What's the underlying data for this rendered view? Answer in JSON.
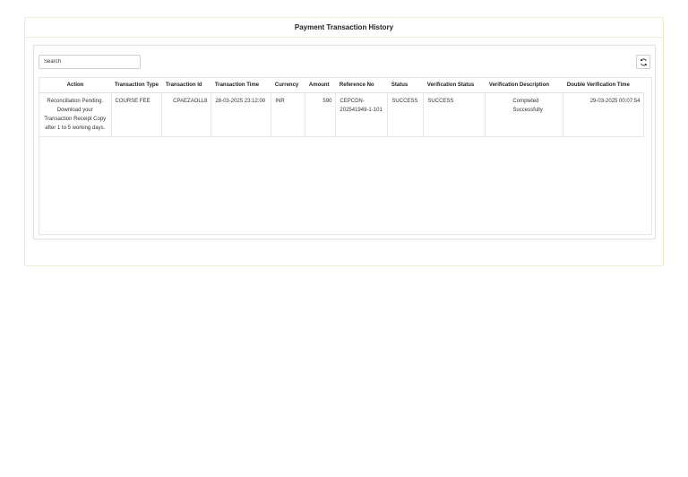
{
  "page": {
    "title": "Payment Transaction History"
  },
  "toolbar": {
    "search_placeholder": "Search",
    "refresh_icon": "refresh-icon"
  },
  "table": {
    "columns": [
      "Action",
      "Transaction Type",
      "Transaction Id",
      "Transaction Time",
      "Currency",
      "Amount",
      "Reference No",
      "Status",
      "Verification Status",
      "Verification Description",
      "Double Verification Time"
    ],
    "rows": [
      {
        "action": "Reconciliation Pending. Download your Transaction Receipt Copy after 1 to 5 working days.",
        "transaction_type": "COURSE FEE",
        "transaction_id": "CPAEZAOLL8",
        "transaction_time": "28-03-2025 23:12:00",
        "currency": "INR",
        "amount": "590",
        "reference_no": "CEPCDN-202541949-1-101",
        "status": "SUCCESS",
        "verification_status": "SUCCESS",
        "verification_description": "Completed Successfully",
        "double_verification_time": "29-03-2025 00:07:54"
      }
    ]
  }
}
